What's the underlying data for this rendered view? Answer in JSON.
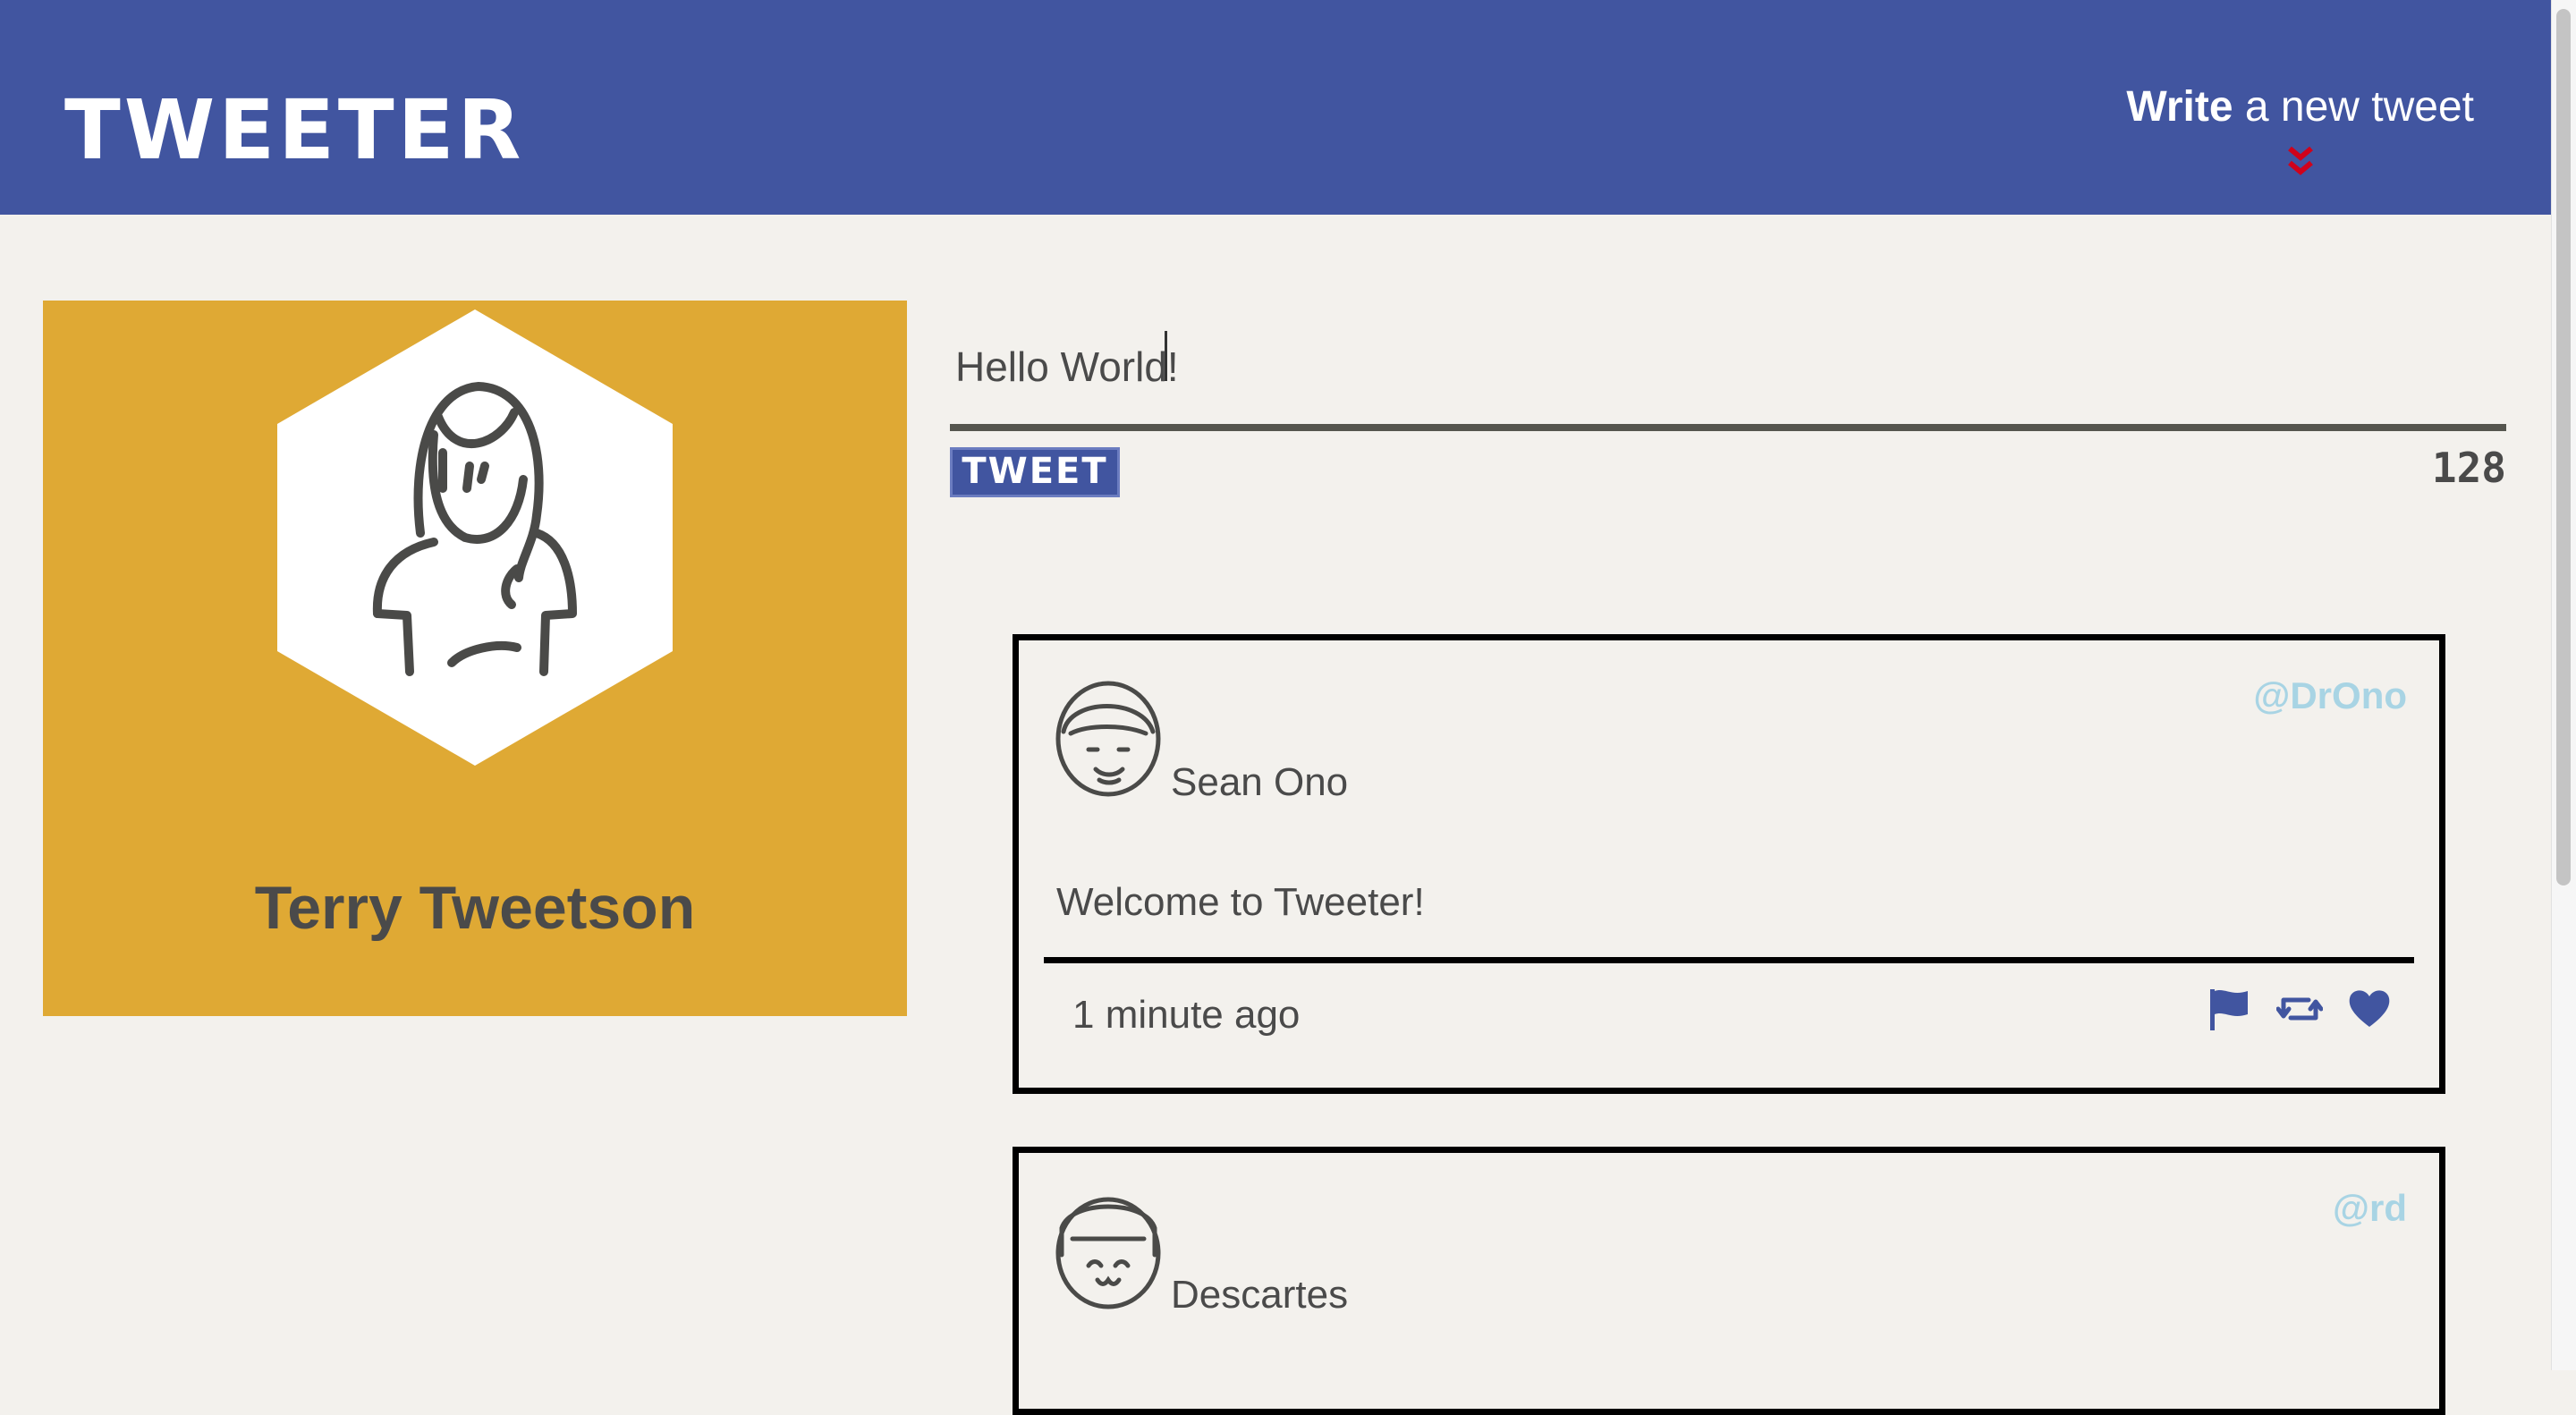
{
  "header": {
    "brand": "TWEETER",
    "compose_toggle_strong": "Write",
    "compose_toggle_rest": " a new tweet"
  },
  "profile": {
    "name": "Terry Tweetson",
    "background_color": "#dfa934"
  },
  "compose": {
    "value": "Hello World!",
    "tweet_button_label": "TWEET",
    "char_counter": "128"
  },
  "tweets": [
    {
      "author": "Sean Ono",
      "handle": "@DrOno",
      "body": "Welcome to Tweeter!",
      "timestamp": "1 minute ago",
      "actions": [
        "flag-icon",
        "retweet-icon",
        "heart-icon"
      ]
    },
    {
      "author": "Descartes",
      "handle": "@rd"
    }
  ],
  "colors": {
    "brand_blue": "#4155a0",
    "chevron_red": "#d0021b",
    "handle_blue": "#a8d4e4",
    "page_bg": "#f3f1ed"
  }
}
